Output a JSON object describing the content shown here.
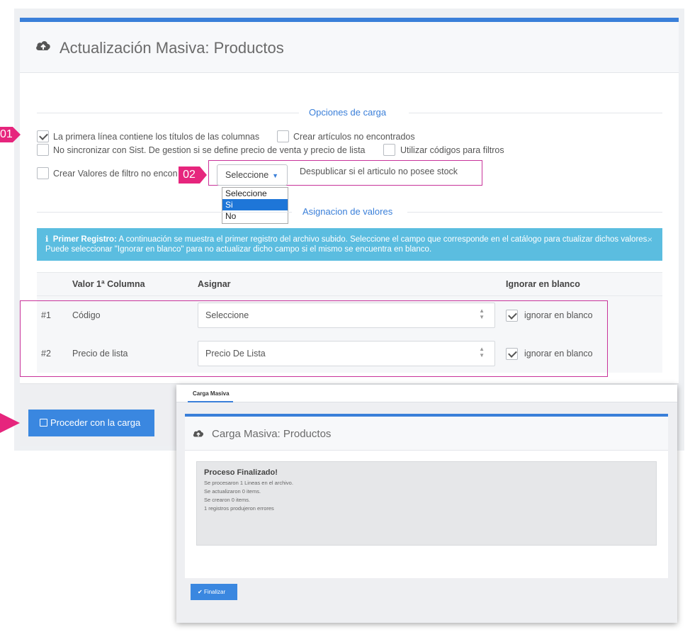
{
  "main": {
    "title": "Actualización Masiva: Productos",
    "section_options": "Opciones de carga",
    "section_assign": "Asignacion de valores",
    "options": [
      {
        "label": "La primera línea contiene los títulos de las columnas",
        "checked": true
      },
      {
        "label": "Crear artículos no encontrados",
        "checked": false
      },
      {
        "label": "No sincronizar con Sist. De gestion si se define precio de venta y precio de lista",
        "checked": false
      },
      {
        "label": "Utilizar códigos para filtros",
        "checked": false
      },
      {
        "label": "Crear Valores de filtro no encon",
        "checked": false
      }
    ],
    "unpublish_select": {
      "value": "Seleccione",
      "label": "Despublicar si el articulo no posee stock",
      "options": [
        "Seleccione",
        "Si",
        "No"
      ],
      "highlighted": "Si"
    },
    "alert": {
      "icon": "ℹ",
      "strong": "Primer Registro:",
      "text": "A continuación se muestra el primer registro del archivo subido. Seleccione el campo que corresponde en el catálogo para ctualizar dichos valores. Puede seleccionar \"Ignorar en blanco\" para no actualizar dicho campo si el mismo se encuentra en blanco.",
      "close": "×"
    },
    "table": {
      "headers": [
        "Valor 1ª Columna",
        "Asignar",
        "Ignorar en blanco"
      ],
      "rows": [
        {
          "num": "#1",
          "value": "Código",
          "assign": "Seleccione",
          "ignore_label": "ignorar en blanco",
          "ignore_checked": true
        },
        {
          "num": "#2",
          "value": "Precio de lista",
          "assign": "Precio De Lista",
          "ignore_label": "ignorar en blanco",
          "ignore_checked": true
        }
      ]
    },
    "proceed_button": "Proceder con la carga"
  },
  "markers": {
    "m1": "01",
    "m2": "02"
  },
  "inset": {
    "tab": "Carga Masiva",
    "title": "Carga Masiva: Productos",
    "result_title": "Proceso Finalizado!",
    "result_lines": [
      "Se procesaron 1 Lineas en el archivo.",
      "Se actualizaron 0 items.",
      "Se crearon 0 items.",
      "1 registros produjeron errores"
    ],
    "finalize_button": "Finalizar"
  },
  "colors": {
    "accent": "#3a7fd9",
    "marker": "#e6257d",
    "info": "#5bbde0",
    "outline": "#c8339a"
  },
  "icons": [
    "cloud-upload-icon",
    "check-icon",
    "caret-down-icon",
    "info-icon",
    "close-icon",
    "sort-arrows-icon",
    "save-icon"
  ]
}
